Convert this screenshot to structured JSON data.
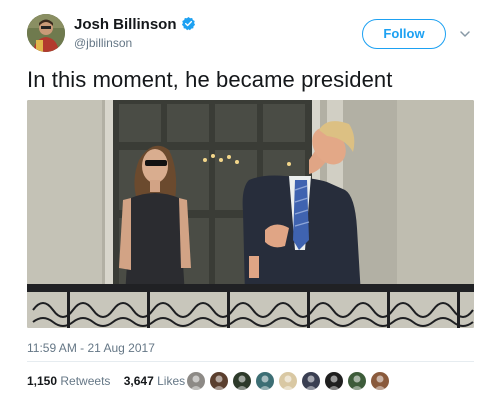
{
  "author": {
    "name": "Josh Billinson",
    "handle": "@jbillinson",
    "verified": true
  },
  "follow_label": "Follow",
  "tweet_text": "In this moment, he became president",
  "timestamp": "11:59 AM - 21 Aug 2017",
  "stats": {
    "retweets_count": "1,150",
    "retweets_label": "Retweets",
    "likes_count": "3,647",
    "likes_label": "Likes"
  },
  "likers": [
    {
      "icon": "liker-avatar",
      "color": "#8d8a86"
    },
    {
      "icon": "liker-avatar",
      "color": "#5b3f2e"
    },
    {
      "icon": "liker-avatar",
      "color": "#2d3a2a"
    },
    {
      "icon": "liker-avatar",
      "color": "#3c6e74"
    },
    {
      "icon": "liker-avatar",
      "color": "#d9c8a3"
    },
    {
      "icon": "liker-avatar",
      "color": "#3a3f52"
    },
    {
      "icon": "liker-avatar",
      "color": "#1f1f1f"
    },
    {
      "icon": "liker-avatar",
      "color": "#3d5c3a"
    },
    {
      "icon": "liker-avatar",
      "color": "#8a5a3c"
    }
  ],
  "colors": {
    "accent": "#1da1f2",
    "secondary_text": "#657786",
    "primary_text": "#14171a"
  }
}
